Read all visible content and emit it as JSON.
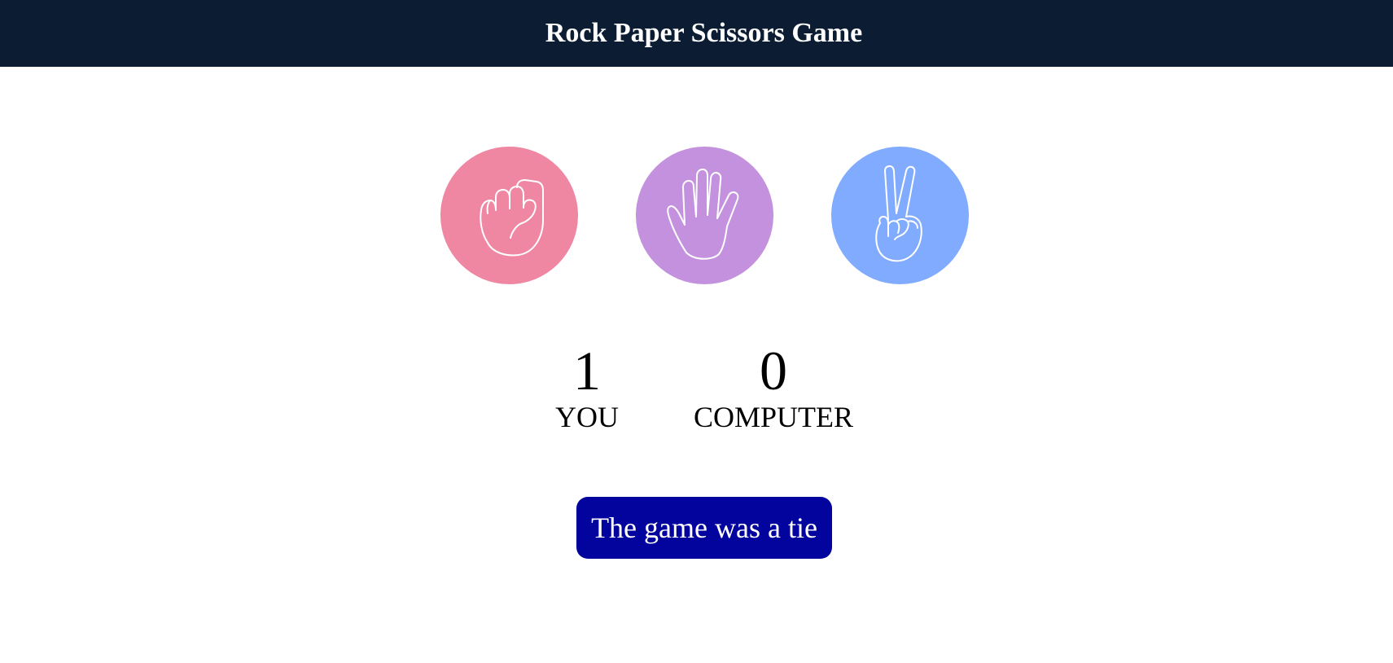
{
  "header": {
    "title": "Rock Paper Scissors Game"
  },
  "choices": [
    {
      "name": "rock",
      "icon": "rock-hand-icon",
      "color": "#ef87a3"
    },
    {
      "name": "paper",
      "icon": "paper-hand-icon",
      "color": "#c391dd"
    },
    {
      "name": "scissors",
      "icon": "scissors-hand-icon",
      "color": "#80abff"
    }
  ],
  "scoreboard": {
    "you": {
      "score": "1",
      "label": "YOU"
    },
    "computer": {
      "score": "0",
      "label": "COMPUTER"
    }
  },
  "result": {
    "text": "The game was a tie",
    "color": "#03039e"
  },
  "colors": {
    "header_bg": "#0b1c33"
  }
}
